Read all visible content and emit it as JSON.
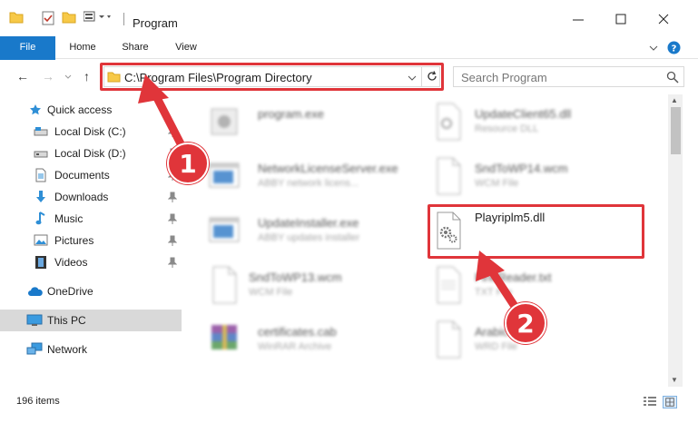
{
  "window": {
    "title": "Program",
    "controls": {
      "minimize_icon": "minimize-icon",
      "maximize_icon": "maximize-icon",
      "close_icon": "close-icon"
    }
  },
  "ribbon": {
    "tabs": [
      {
        "label": "File"
      },
      {
        "label": "Home"
      },
      {
        "label": "Share"
      },
      {
        "label": "View"
      }
    ]
  },
  "address": {
    "path": "C:\\Program Files\\Program Directory",
    "search_placeholder": "Search Program"
  },
  "nav": {
    "items": [
      {
        "label": "Quick access"
      },
      {
        "label": "Local Disk (C:)"
      },
      {
        "label": "Local Disk (D:)"
      },
      {
        "label": "Documents"
      },
      {
        "label": "Downloads"
      },
      {
        "label": "Music"
      },
      {
        "label": "Pictures"
      },
      {
        "label": "Videos"
      },
      {
        "label": "OneDrive"
      },
      {
        "label": "This PC"
      },
      {
        "label": "Network"
      }
    ]
  },
  "files": [
    {
      "name": "program.exe",
      "desc": ""
    },
    {
      "name": "UpdateClient65.dll",
      "desc": "Resource DLL"
    },
    {
      "name": "NetworkLicenseServer.exe",
      "desc": "ABBY network licens..."
    },
    {
      "name": "SndToWP14.wcm",
      "desc": "WCM File"
    },
    {
      "name": "UpdateInstaller.exe",
      "desc": "ABBY updates installer"
    },
    {
      "name": "Playriplm5.dll",
      "desc": ""
    },
    {
      "name": "SndToWP13.wcm",
      "desc": "WCM File"
    },
    {
      "name": "FineReader.txt",
      "desc": "TXT File"
    },
    {
      "name": "certificates.cab",
      "desc": "WinRAR Archive"
    },
    {
      "name": "Arabic.dic",
      "desc": "WRD File"
    }
  ],
  "status": {
    "item_count": "196 items"
  },
  "annotations": {
    "step1": "1",
    "step2": "2"
  },
  "colors": {
    "accent": "#1979ca",
    "highlight": "#e0353a",
    "folder": "#f7c948"
  }
}
